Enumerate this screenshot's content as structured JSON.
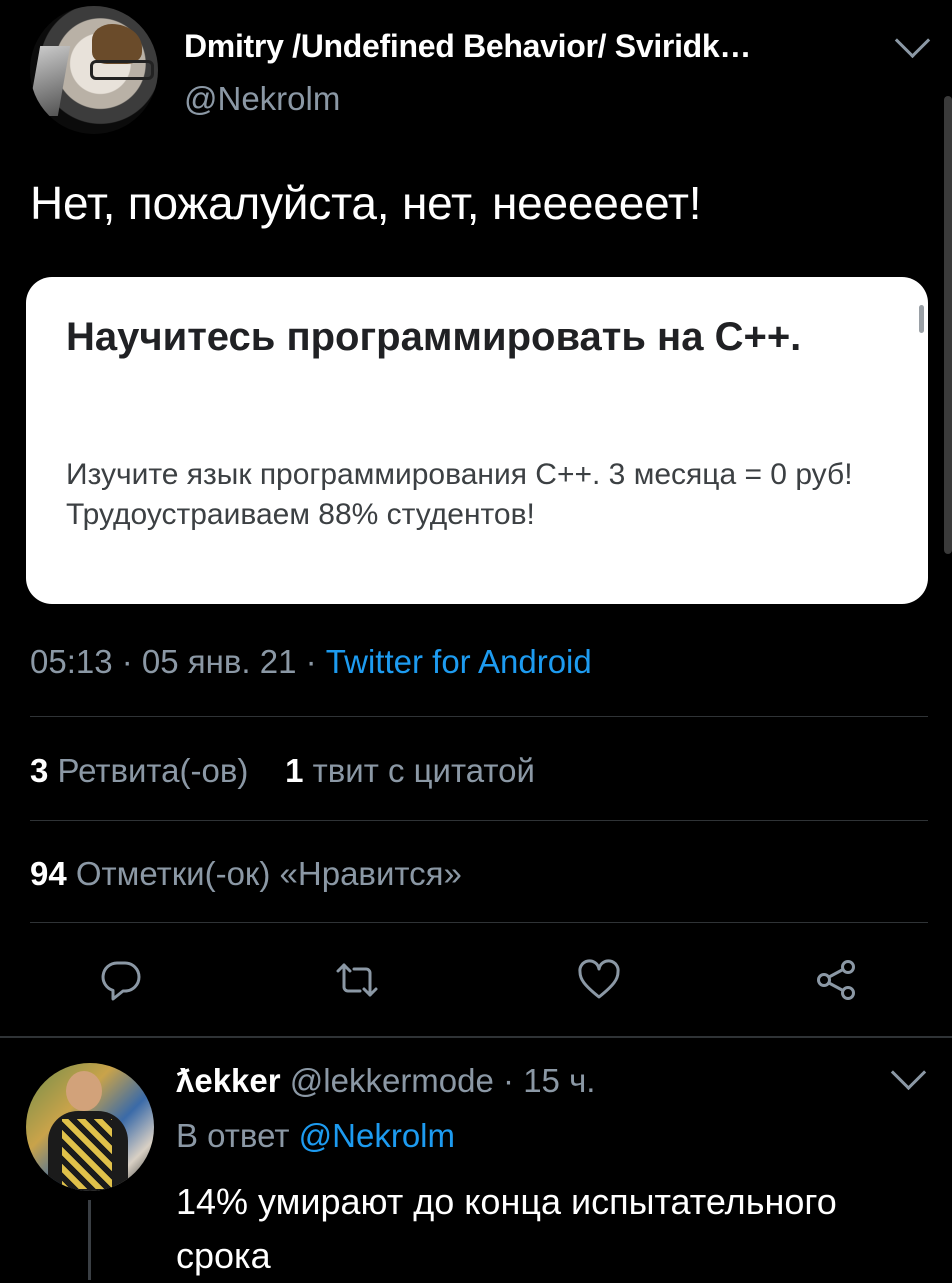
{
  "tweet": {
    "author": {
      "display_name": "Dmitry /Undefined Behavior/ Sviridk…",
      "handle": "@Nekrolm"
    },
    "text": "Нет, пожалуйста, нет, неееееет!",
    "quoted_card": {
      "title": "Научитесь программировать на C++.",
      "body": "Изучите язык программирования C++. 3 месяца = 0 руб! Трудоустраиваем 88% студентов!"
    },
    "meta": {
      "time": "05:13",
      "date": "05 янв. 21",
      "separator": " · ",
      "source": "Twitter for Android"
    },
    "stats": {
      "retweets_count": "3",
      "retweets_label": "Ретвита(-ов)",
      "quotes_count": "1",
      "quotes_label": "твит с цитатой",
      "likes_count": "94",
      "likes_label": "Отметки(-ок) «Нравится»"
    },
    "actions": [
      {
        "icon": "reply-icon"
      },
      {
        "icon": "retweet-icon"
      },
      {
        "icon": "like-icon"
      },
      {
        "icon": "share-icon"
      }
    ]
  },
  "reply": {
    "author_name": "ƛekker",
    "handle": "@lekkermode",
    "time_ago": "15 ч.",
    "reply_to_label": "В ответ",
    "reply_to_handle": "@Nekrolm",
    "text": "14% умирают до конца испытательного срока"
  },
  "colors": {
    "background": "#000000",
    "secondary_text": "#8b98a5",
    "accent": "#1d9bf0",
    "divider": "#2f3336"
  }
}
